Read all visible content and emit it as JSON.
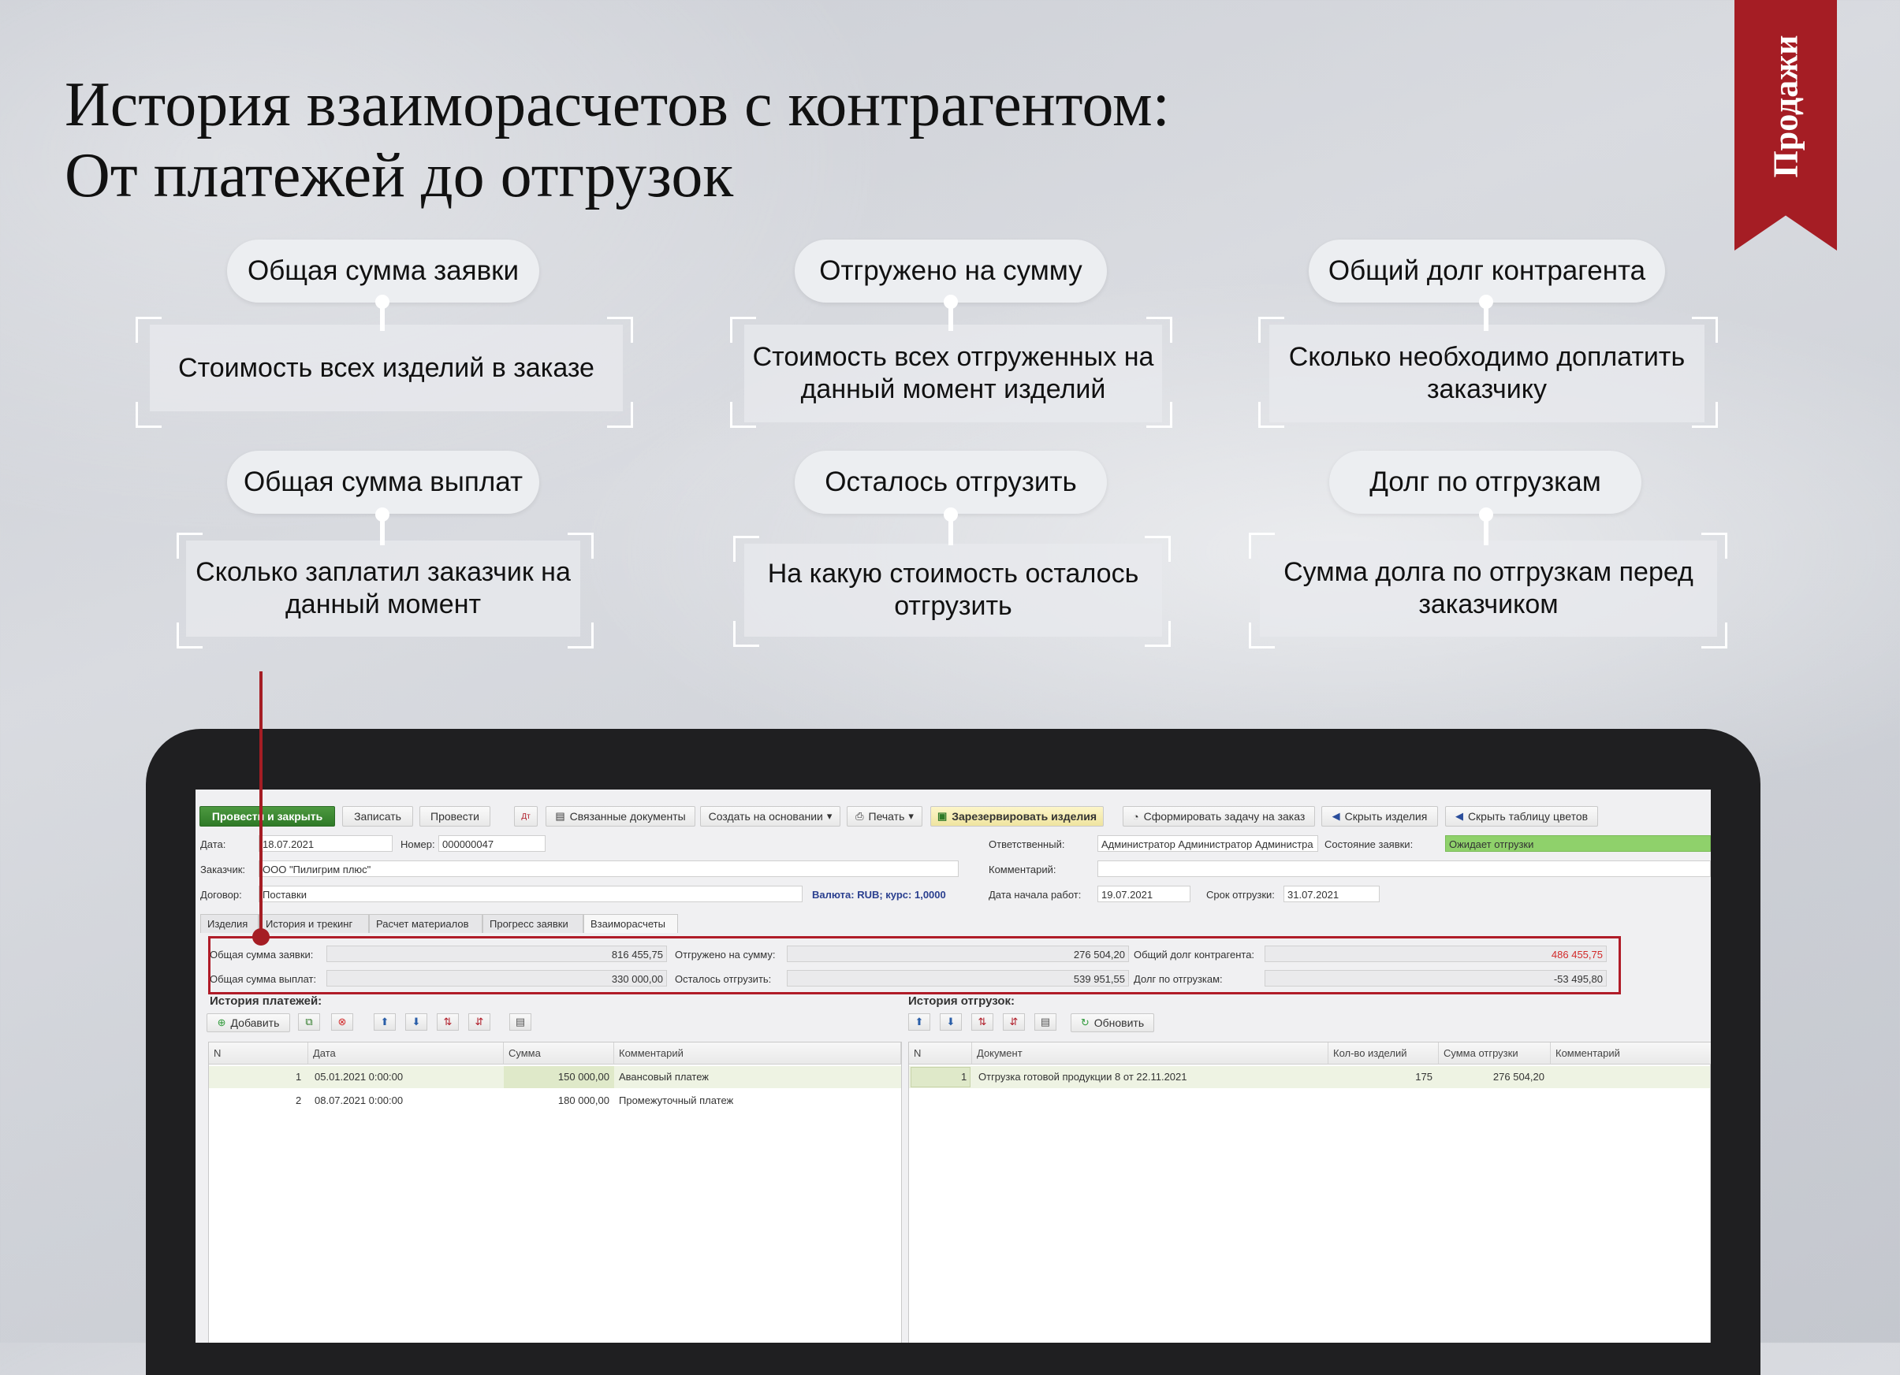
{
  "title": {
    "line1": "История взаиморасчетов с контрагентом:",
    "line2": "От платежей до отгрузок"
  },
  "ribbon": {
    "label": "Продажи"
  },
  "callouts": [
    {
      "title": "Общая сумма заявки",
      "desc": "Стоимость всех изделий в заказе"
    },
    {
      "title": "Отгружено на сумму",
      "desc": "Стоимость всех отгруженных на данный момент изделий"
    },
    {
      "title": "Общий долг контрагента",
      "desc": "Сколько необходимо доплатить заказчику"
    },
    {
      "title": "Общая сумма выплат",
      "desc": "Сколько заплатил заказчик на данный момент"
    },
    {
      "title": "Осталось отгрузить",
      "desc": "На какую стоимость осталось отгрузить"
    },
    {
      "title": "Долг по отгрузкам",
      "desc": "Сумма долга по отгрузкам перед заказчиком"
    }
  ],
  "toolbar": {
    "post_close": "Провести и закрыть",
    "save": "Записать",
    "post": "Провести",
    "linked_docs": "Связанные документы",
    "create_based": "Создать на основании",
    "print": "Печать",
    "reserve": "Зарезервировать изделия",
    "form_task": "Сформировать задачу на заказ",
    "hide_items": "Скрыть изделия",
    "hide_colors": "Скрыть таблицу цветов"
  },
  "form": {
    "date_label": "Дата:",
    "date_value": "18.07.2021",
    "number_label": "Номер:",
    "number_value": "000000047",
    "responsible_label": "Ответственный:",
    "responsible_value": "Администратор Администратор Администра",
    "status_label": "Состояние заявки:",
    "status_value": "Ожидает отгрузки",
    "customer_label": "Заказчик:",
    "customer_value": "ООО \"Пилигрим плюс\"",
    "comment_label": "Комментарий:",
    "comment_value": "",
    "contract_label": "Договор:",
    "contract_value": "Поставки",
    "currency_text": "Валюта: RUB; курс: 1,0000",
    "start_label": "Дата начала работ:",
    "start_value": "19.07.2021",
    "ship_label": "Срок отгрузки:",
    "ship_value": "31.07.2021"
  },
  "tabs": [
    "Изделия",
    "История и трекинг",
    "Расчет материалов",
    "Прогресс заявки",
    "Взаиморасчеты"
  ],
  "summary": {
    "total_label": "Общая сумма заявки:",
    "total_value": "816 455,75",
    "shipped_label": "Отгружено на сумму:",
    "shipped_value": "276 504,20",
    "debt_label": "Общий долг контрагента:",
    "debt_value": "486 455,75",
    "paid_label": "Общая сумма выплат:",
    "paid_value": "330 000,00",
    "remaining_label": "Осталось отгрузить:",
    "remaining_value": "539 951,55",
    "ship_debt_label": "Долг по отгрузкам:",
    "ship_debt_value": "-53 495,80",
    "debt_color": "#d22a2a"
  },
  "payments": {
    "title": "История платежей:",
    "add_label": "Добавить",
    "columns": [
      "N",
      "Дата",
      "Сумма",
      "Комментарий"
    ],
    "rows": [
      {
        "n": "1",
        "date": "05.01.2021 0:00:00",
        "sum": "150 000,00",
        "comment": "Авансовый платеж"
      },
      {
        "n": "2",
        "date": "08.07.2021 0:00:00",
        "sum": "180 000,00",
        "comment": "Промежуточный платеж"
      }
    ]
  },
  "shipments": {
    "title": "История отгрузок:",
    "refresh_label": "Обновить",
    "columns": [
      "N",
      "Документ",
      "Кол-во изделий",
      "Сумма отгрузки",
      "Комментарий"
    ],
    "rows": [
      {
        "n": "1",
        "doc": "Отгрузка готовой продукции 8 от 22.11.2021",
        "qty": "175",
        "sum": "276 504,20",
        "comment": ""
      }
    ]
  },
  "colors": {
    "accent_red": "#a51d24",
    "status_green": "#8fd16b"
  }
}
